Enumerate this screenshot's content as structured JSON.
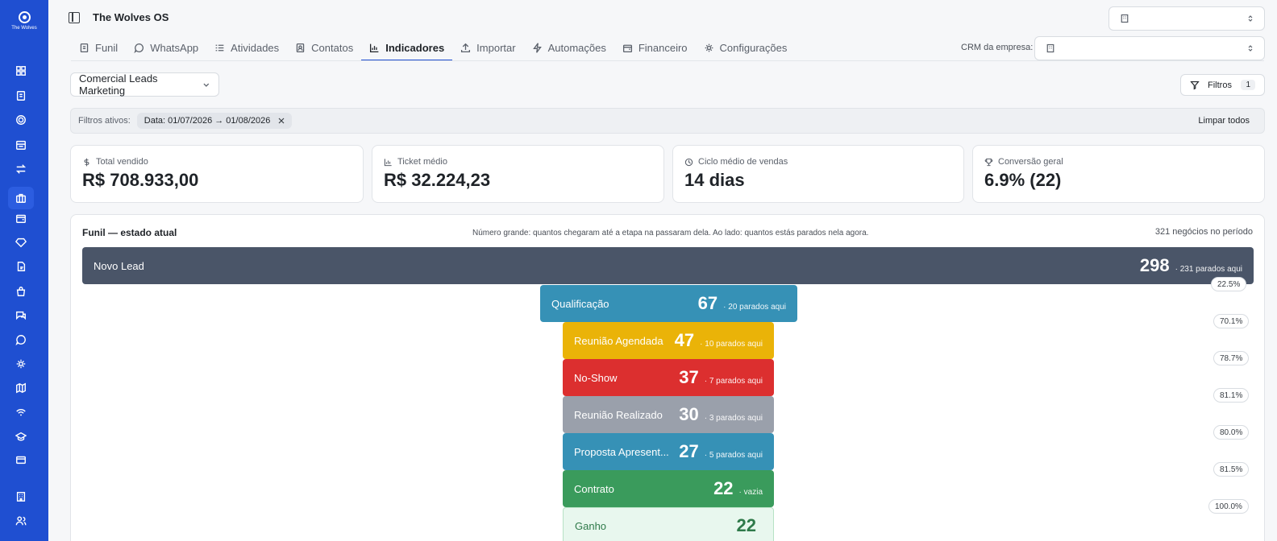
{
  "app": {
    "title": "The Wolves OS",
    "logo_text": "The Wolves"
  },
  "sidebar": {
    "icons": [
      "grid-icon",
      "clipboard-icon",
      "target-icon",
      "calendar-icon",
      "arrows-icon",
      "briefcase-icon",
      "wallet-icon",
      "diamond-icon",
      "document-icon",
      "bag-icon",
      "chat-icon",
      "message-icon",
      "settings-cog-icon",
      "map-icon",
      "wifi-icon",
      "school-icon",
      "card-icon",
      "building-icon",
      "users-icon"
    ],
    "active": "briefcase-icon"
  },
  "tabs": [
    {
      "label": "Funil",
      "icon": "document-icon"
    },
    {
      "label": "WhatsApp",
      "icon": "chat-icon"
    },
    {
      "label": "Atividades",
      "icon": "list-icon"
    },
    {
      "label": "Contatos",
      "icon": "contacts-icon"
    },
    {
      "label": "Indicadores",
      "icon": "bar-chart-icon",
      "active": true
    },
    {
      "label": "Importar",
      "icon": "upload-icon"
    },
    {
      "label": "Automações",
      "icon": "bolt-icon"
    },
    {
      "label": "Financeiro",
      "icon": "wallet-icon"
    },
    {
      "label": "Configurações",
      "icon": "gear-icon"
    }
  ],
  "crm": {
    "label": "CRM da empresa:",
    "value": ""
  },
  "pipeline": {
    "selected": "Comercial Leads Marketing"
  },
  "filters": {
    "label": "Filtros",
    "count": "1"
  },
  "active_filters": {
    "label": "Filtros ativos:",
    "chips": [
      {
        "text": "Data: 01/07/2026 → 01/08/2026"
      }
    ],
    "clear_label": "Limpar todos"
  },
  "kpis": [
    {
      "label": "Total vendido",
      "value": "R$ 708.933,00",
      "icon": "dollar-icon"
    },
    {
      "label": "Ticket médio",
      "value": "R$ 32.224,23",
      "icon": "bar-chart-icon"
    },
    {
      "label": "Ciclo médio de vendas",
      "value": "14 dias",
      "icon": "clock-icon"
    },
    {
      "label": "Conversão geral",
      "value": "6.9% (22)",
      "icon": "trophy-icon"
    }
  ],
  "funnel": {
    "title": "Funil — estado atual",
    "hint": "Número grande: quantos chegaram até a etapa na passaram dela. Ao lado: quantos estás parados nela agora.",
    "total": "321 negócios no período",
    "stages": [
      {
        "name": "Novo Lead",
        "count": "298",
        "sub": "· 231 parados aqui",
        "color": "#4a5568"
      },
      {
        "name": "Qualificação",
        "count": "67",
        "sub": "· 20 parados aqui",
        "color": "#3691b6"
      },
      {
        "name": "Reunião Agendada",
        "count": "47",
        "sub": "· 10 parados aqui",
        "color": "#eab308"
      },
      {
        "name": "No-Show",
        "count": "37",
        "sub": "· 7 parados aqui",
        "color": "#dc2f2f"
      },
      {
        "name": "Reunião Realizado",
        "count": "30",
        "sub": "· 3 parados aqui",
        "color": "#9aa0ab"
      },
      {
        "name": "Proposta Apresent...",
        "count": "27",
        "sub": "· 5 parados aqui",
        "color": "#3691b6"
      },
      {
        "name": "Contrato",
        "count": "22",
        "sub": "· vazia",
        "color": "#3a9b5c"
      },
      {
        "name": "Ganho",
        "count": "22",
        "sub": "",
        "color": "#e8f7ee"
      }
    ],
    "conversions": [
      "22.5%",
      "70.1%",
      "78.7%",
      "81.1%",
      "80.0%",
      "81.5%",
      "100.0%"
    ]
  }
}
